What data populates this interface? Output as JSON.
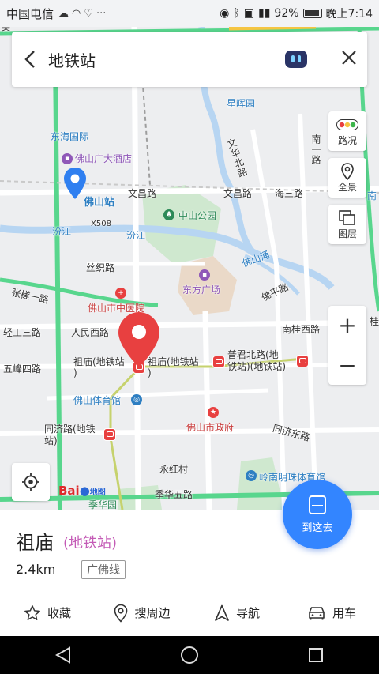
{
  "status_bar": {
    "carrier": "中国电信",
    "battery": "92%",
    "time": "晚上7:14"
  },
  "search": {
    "query": "地铁站"
  },
  "tools": {
    "traffic": "路况",
    "panorama": "全景",
    "layers": "图层",
    "zoom_in": "+",
    "zoom_out": "−"
  },
  "map_labels": {
    "xinghui_yuan": "星晖园",
    "donghai_guoji": "东海国际",
    "foshan_guangda_hotel": "佛山广大酒店",
    "foshan_station": "佛山站",
    "wenchang_road_1": "文昌路",
    "wenchang_road_2": "文昌路",
    "haisan_road": "海三路",
    "zhongshan_park": "中山公园",
    "x508": "X508",
    "fenjiang_1": "汾江",
    "fenjiang_2": "汾江",
    "sizhi_road": "丝织路",
    "foshan_yong": "佛山涌",
    "dongfang_plaza": "东方广场",
    "zhangcha_road": "张槎一路",
    "foshan_tcm_hospital": "佛山市中医院",
    "foping_road": "佛平路",
    "renmin_west_road": "人民西路",
    "nangui_west_road": "南桂西路",
    "qinggong_road": "轻工三路",
    "wufeng_road": "五峰四路",
    "zumiao_left": "祖庙(地铁站\n)",
    "zumiao_right": "祖庙(地铁站\n)",
    "pujun_north": "普君北路(地\n铁站)(地铁站)",
    "foshan_stadium": "佛山体育馆",
    "foshan_gov": "佛山市政府",
    "tongji_road_station": "同济路(地铁\n站)",
    "tongji_east_road": "同济东路",
    "yonghong_village": "永红村",
    "lingnan_stadium": "岭南明珠体育馆",
    "jihua_yuan": "季华园",
    "jihua_road": "季华五路",
    "wenhua_north_road": "文华北路",
    "nan_yi_road": "南一路",
    "nan_edge": "南",
    "gui_edge": "桂",
    "jihua_short": "季华",
    "wei_edge": "美"
  },
  "logo": {
    "baidu": "Bai",
    "map_word": "地图"
  },
  "go_button": {
    "label": "到这去"
  },
  "place": {
    "name": "祖庙",
    "type": "(地铁站)",
    "distance": "2.4km",
    "line": "广佛线"
  },
  "actions": [
    {
      "label": "收藏",
      "icon": "star-icon"
    },
    {
      "label": "搜周边",
      "icon": "location-pin-icon"
    },
    {
      "label": "导航",
      "icon": "navigation-arrow-icon"
    },
    {
      "label": "用车",
      "icon": "car-icon"
    }
  ],
  "colors": {
    "accent_blue": "#3385ff",
    "pin_red": "#e84040",
    "metro_red": "#e84040",
    "road_green": "#58d68d",
    "station_pin_blue": "#2f7ff0"
  }
}
